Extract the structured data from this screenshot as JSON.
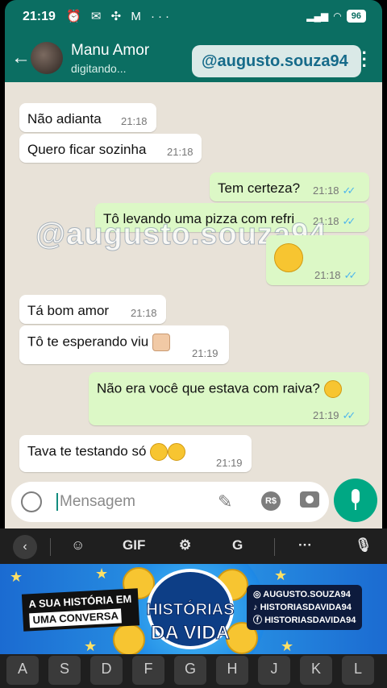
{
  "status_bar": {
    "time": "21:19",
    "icons": "⏰ ✉ ✣ M ···",
    "signal": "📶",
    "wifi": "wifi",
    "battery": "96"
  },
  "header": {
    "back": "←",
    "contact_name": "Manu Amor",
    "contact_status": "digitando...",
    "watermark": "@augusto.souza94",
    "menu": "⋮"
  },
  "watermark_mid": "@augusto.souza94",
  "messages": [
    {
      "dir": "in",
      "text": "Não adianta",
      "time": "21:18"
    },
    {
      "dir": "in",
      "text": "Quero ficar sozinha",
      "time": "21:18"
    },
    {
      "dir": "out",
      "text": "Tem certeza?",
      "time": "21:18",
      "read": "✓✓"
    },
    {
      "dir": "out",
      "text": "Tô levando uma pizza com refri",
      "time": "21:18",
      "read": "✓✓"
    },
    {
      "dir": "out",
      "text": "",
      "emoji": "smirking-face",
      "time": "21:18",
      "read": "✓✓"
    },
    {
      "dir": "in",
      "text": "Tá bom amor",
      "time": "21:18"
    },
    {
      "dir": "in",
      "text": "Tô te esperando viu",
      "emoji": "heart-hands",
      "time": "21:19"
    },
    {
      "dir": "out",
      "text": "Não era você que estava com raiva?",
      "emoji": "thinking-face",
      "time": "21:19",
      "read": "✓✓"
    },
    {
      "dir": "in",
      "text": "Tava te testando só",
      "emoji": "rolling-laughing-face x2",
      "time": "21:19"
    }
  ],
  "composer": {
    "placeholder": "Mensagem",
    "rs": "R$"
  },
  "keyboard_bar": {
    "back": "‹",
    "gif": "GIF",
    "more": "···"
  },
  "banner": {
    "tag_line1": "A SUA HISTÓRIA EM",
    "tag_line2": "UMA CONVERSA",
    "logo_line1": "HISTÓRIAS",
    "logo_line2": "DA VIDA",
    "social": [
      "AUGUSTO.SOUZA94",
      "HISTORIASDAVIDA94",
      "HISTORIASDAVIDA94"
    ]
  },
  "keys": [
    "A",
    "S",
    "D",
    "F",
    "G",
    "H",
    "J",
    "K",
    "L"
  ]
}
